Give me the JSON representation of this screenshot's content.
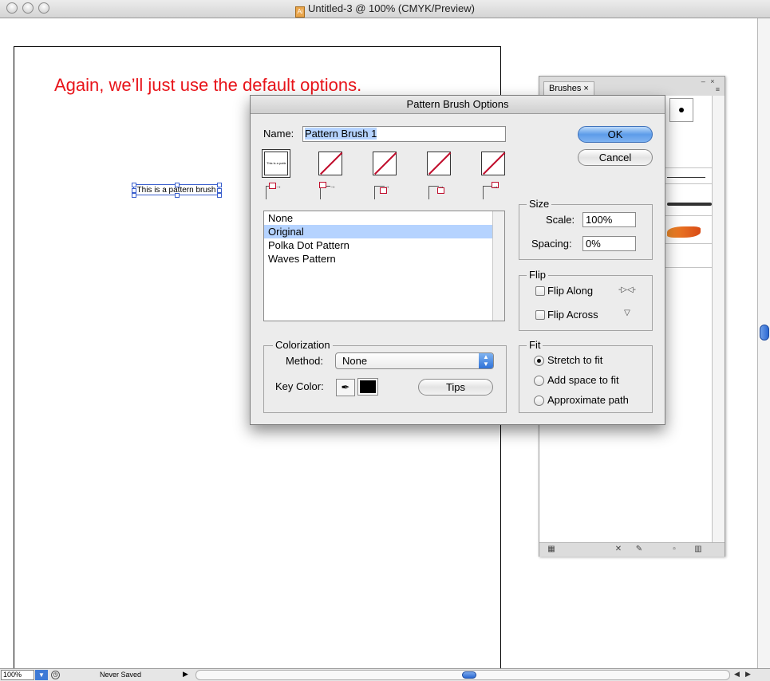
{
  "window": {
    "title": "Untitled-3 @ 100% (CMYK/Preview)"
  },
  "annotation": "Again, we’ll just use the default options.",
  "canvas": {
    "selected_text": "This is a pattern brush"
  },
  "status_bar": {
    "zoom": "100%",
    "save_state": "Never Saved"
  },
  "brushes_panel": {
    "tab_label": "Brushes",
    "close_glyph": "×"
  },
  "dialog": {
    "title": "Pattern Brush Options",
    "name_label": "Name:",
    "name_value": "Pattern Brush 1",
    "ok_label": "OK",
    "cancel_label": "Cancel",
    "pattern_list": [
      "None",
      "Original",
      "Polka Dot Pattern",
      "Waves Pattern"
    ],
    "selected_pattern": "Original",
    "size": {
      "title": "Size",
      "scale_label": "Scale:",
      "scale_value": "100%",
      "spacing_label": "Spacing:",
      "spacing_value": "0%"
    },
    "flip": {
      "title": "Flip",
      "along_label": "Flip Along",
      "across_label": "Flip Across",
      "along_checked": false,
      "across_checked": false
    },
    "colorization": {
      "title": "Colorization",
      "method_label": "Method:",
      "method_value": "None",
      "key_color_label": "Key Color:",
      "key_color": "#000000",
      "tips_label": "Tips"
    },
    "fit": {
      "title": "Fit",
      "options": [
        "Stretch to fit",
        "Add space to fit",
        "Approximate path"
      ],
      "selected": "Stretch to fit"
    }
  },
  "colors": {
    "annotation": "#e8141a",
    "list_selection": "#b5d3ff",
    "accent": "#2a68d2",
    "tile_slash": "#c00d2c"
  }
}
